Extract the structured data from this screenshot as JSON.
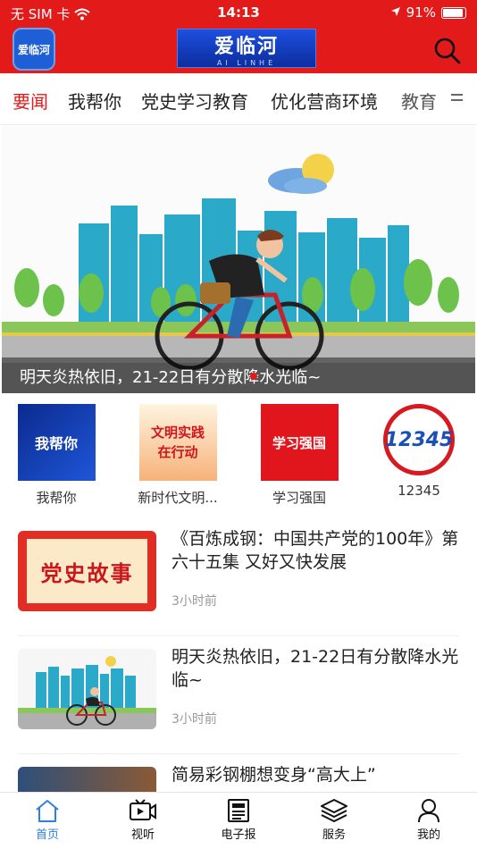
{
  "status_bar": {
    "carrier": "无 SIM 卡",
    "time": "14:13",
    "battery": "91%"
  },
  "header": {
    "logo_text": "爱临河",
    "brand_title": "爱临河",
    "brand_sub": "AI LINHE"
  },
  "tabs": [
    {
      "label": "要闻"
    },
    {
      "label": "我帮你"
    },
    {
      "label": "党史学习教育"
    },
    {
      "label": "优化营商环境"
    },
    {
      "label": "教育"
    }
  ],
  "banner": {
    "caption": "明天炎热依旧，21-22日有分散降水光临~"
  },
  "quick": [
    {
      "label": "我帮你",
      "img_text": "我帮你"
    },
    {
      "label": "新时代文明...",
      "img_text": "文明实践在行动"
    },
    {
      "label": "学习强国",
      "img_text": "学习强国"
    },
    {
      "label": "12345",
      "img_text": "12345"
    }
  ],
  "news": [
    {
      "title": "《百炼成钢：中国共产党的100年》第六十五集 又好又快发展",
      "time": "3小时前",
      "thumb_text": "党史故事"
    },
    {
      "title": "明天炎热依旧，21-22日有分散降水光临~",
      "time": "3小时前"
    },
    {
      "title": "简易彩钢棚想变身“高大上”",
      "time": ""
    }
  ],
  "bottom_nav": [
    {
      "label": "首页"
    },
    {
      "label": "视听"
    },
    {
      "label": "电子报"
    },
    {
      "label": "服务"
    },
    {
      "label": "我的"
    }
  ],
  "colors": {
    "brand_red": "#e21a1a",
    "nav_active": "#2f7fe0"
  }
}
